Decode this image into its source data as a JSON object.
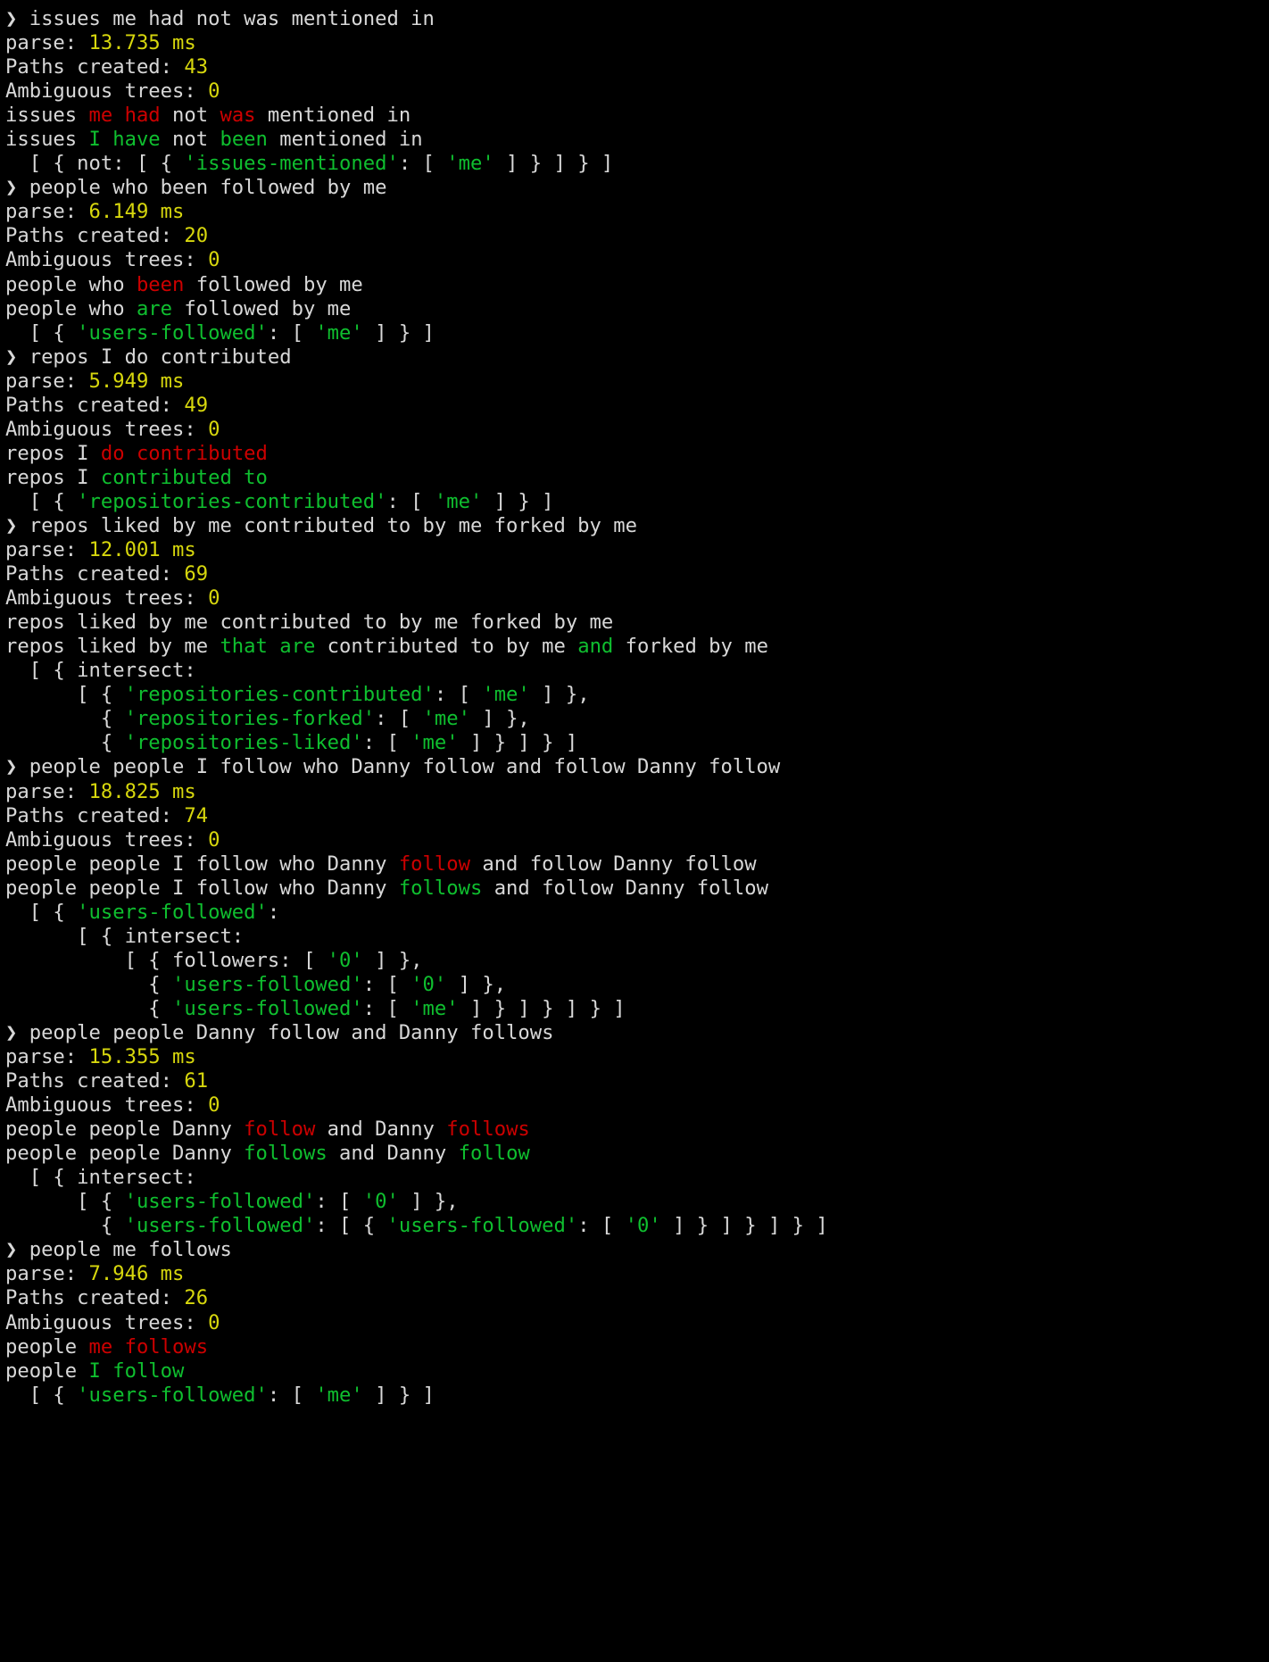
{
  "terminal": {
    "title": "terminal-session",
    "background_color": "#000000",
    "colors": {
      "white": "#d8d8d8",
      "red": "#cc0000",
      "green": "#0fbf2f",
      "yellow": "#d7d70d"
    },
    "prompt_symbol": "❯",
    "labels": {
      "parse": "parse:",
      "paths_created": "Paths created:",
      "ambiguous_trees": "Ambiguous trees:",
      "ms_unit": "ms"
    },
    "sessions": [
      {
        "command": "issues me had not was mentioned in",
        "parse_time": "13.735",
        "paths_created": "43",
        "ambiguous_trees": "0",
        "input_line": [
          {
            "t": "issues ",
            "c": "white"
          },
          {
            "t": "me had",
            "c": "red"
          },
          {
            "t": " not ",
            "c": "white"
          },
          {
            "t": "was",
            "c": "red"
          },
          {
            "t": " mentioned in",
            "c": "white"
          }
        ],
        "corrected_line": [
          {
            "t": "issues ",
            "c": "white"
          },
          {
            "t": "I have",
            "c": "green"
          },
          {
            "t": " not ",
            "c": "white"
          },
          {
            "t": "been",
            "c": "green"
          },
          {
            "t": " mentioned in",
            "c": "white"
          }
        ],
        "result_lines": [
          [
            {
              "t": "  [ { not: [ { ",
              "c": "white"
            },
            {
              "t": "'issues-mentioned'",
              "c": "green"
            },
            {
              "t": ": [ ",
              "c": "white"
            },
            {
              "t": "'me'",
              "c": "green"
            },
            {
              "t": " ] } ] } ]",
              "c": "white"
            }
          ]
        ]
      },
      {
        "command": "people who been followed by me",
        "parse_time": "6.149",
        "paths_created": "20",
        "ambiguous_trees": "0",
        "input_line": [
          {
            "t": "people who ",
            "c": "white"
          },
          {
            "t": "been",
            "c": "red"
          },
          {
            "t": " followed by me",
            "c": "white"
          }
        ],
        "corrected_line": [
          {
            "t": "people who ",
            "c": "white"
          },
          {
            "t": "are",
            "c": "green"
          },
          {
            "t": " followed by me",
            "c": "white"
          }
        ],
        "result_lines": [
          [
            {
              "t": "  [ { ",
              "c": "white"
            },
            {
              "t": "'users-followed'",
              "c": "green"
            },
            {
              "t": ": [ ",
              "c": "white"
            },
            {
              "t": "'me'",
              "c": "green"
            },
            {
              "t": " ] } ]",
              "c": "white"
            }
          ]
        ]
      },
      {
        "command": "repos I do contributed",
        "parse_time": "5.949",
        "paths_created": "49",
        "ambiguous_trees": "0",
        "input_line": [
          {
            "t": "repos I ",
            "c": "white"
          },
          {
            "t": "do contributed",
            "c": "red"
          }
        ],
        "corrected_line": [
          {
            "t": "repos I ",
            "c": "white"
          },
          {
            "t": "contributed to",
            "c": "green"
          }
        ],
        "result_lines": [
          [
            {
              "t": "  [ { ",
              "c": "white"
            },
            {
              "t": "'repositories-contributed'",
              "c": "green"
            },
            {
              "t": ": [ ",
              "c": "white"
            },
            {
              "t": "'me'",
              "c": "green"
            },
            {
              "t": " ] } ]",
              "c": "white"
            }
          ]
        ]
      },
      {
        "command": "repos liked by me contributed to by me forked by me",
        "parse_time": "12.001",
        "paths_created": "69",
        "ambiguous_trees": "0",
        "input_line": [
          {
            "t": "repos liked by me contributed to by me forked by me",
            "c": "white"
          }
        ],
        "corrected_line": [
          {
            "t": "repos liked by me ",
            "c": "white"
          },
          {
            "t": "that are",
            "c": "green"
          },
          {
            "t": " contributed to by me ",
            "c": "white"
          },
          {
            "t": "and",
            "c": "green"
          },
          {
            "t": " forked by me",
            "c": "white"
          }
        ],
        "result_lines": [
          [
            {
              "t": "  [ { intersect:",
              "c": "white"
            }
          ],
          [
            {
              "t": "      [ { ",
              "c": "white"
            },
            {
              "t": "'repositories-contributed'",
              "c": "green"
            },
            {
              "t": ": [ ",
              "c": "white"
            },
            {
              "t": "'me'",
              "c": "green"
            },
            {
              "t": " ] },",
              "c": "white"
            }
          ],
          [
            {
              "t": "        { ",
              "c": "white"
            },
            {
              "t": "'repositories-forked'",
              "c": "green"
            },
            {
              "t": ": [ ",
              "c": "white"
            },
            {
              "t": "'me'",
              "c": "green"
            },
            {
              "t": " ] },",
              "c": "white"
            }
          ],
          [
            {
              "t": "        { ",
              "c": "white"
            },
            {
              "t": "'repositories-liked'",
              "c": "green"
            },
            {
              "t": ": [ ",
              "c": "white"
            },
            {
              "t": "'me'",
              "c": "green"
            },
            {
              "t": " ] } ] } ]",
              "c": "white"
            }
          ]
        ]
      },
      {
        "command": "people people I follow who Danny follow and follow Danny follow",
        "parse_time": "18.825",
        "paths_created": "74",
        "ambiguous_trees": "0",
        "input_line": [
          {
            "t": "people people I follow who Danny ",
            "c": "white"
          },
          {
            "t": "follow",
            "c": "red"
          },
          {
            "t": " and follow Danny follow",
            "c": "white"
          }
        ],
        "corrected_line": [
          {
            "t": "people people I follow who Danny ",
            "c": "white"
          },
          {
            "t": "follows",
            "c": "green"
          },
          {
            "t": " and follow Danny follow",
            "c": "white"
          }
        ],
        "result_lines": [
          [
            {
              "t": "  [ { ",
              "c": "white"
            },
            {
              "t": "'users-followed'",
              "c": "green"
            },
            {
              "t": ":",
              "c": "white"
            }
          ],
          [
            {
              "t": "      [ { intersect:",
              "c": "white"
            }
          ],
          [
            {
              "t": "          [ { followers: [ ",
              "c": "white"
            },
            {
              "t": "'0'",
              "c": "green"
            },
            {
              "t": " ] },",
              "c": "white"
            }
          ],
          [
            {
              "t": "            { ",
              "c": "white"
            },
            {
              "t": "'users-followed'",
              "c": "green"
            },
            {
              "t": ": [ ",
              "c": "white"
            },
            {
              "t": "'0'",
              "c": "green"
            },
            {
              "t": " ] },",
              "c": "white"
            }
          ],
          [
            {
              "t": "            { ",
              "c": "white"
            },
            {
              "t": "'users-followed'",
              "c": "green"
            },
            {
              "t": ": [ ",
              "c": "white"
            },
            {
              "t": "'me'",
              "c": "green"
            },
            {
              "t": " ] } ] } ] } ]",
              "c": "white"
            }
          ]
        ]
      },
      {
        "command": "people people Danny follow and Danny follows",
        "parse_time": "15.355",
        "paths_created": "61",
        "ambiguous_trees": "0",
        "input_line": [
          {
            "t": "people people Danny ",
            "c": "white"
          },
          {
            "t": "follow",
            "c": "red"
          },
          {
            "t": " and Danny ",
            "c": "white"
          },
          {
            "t": "follows",
            "c": "red"
          }
        ],
        "corrected_line": [
          {
            "t": "people people Danny ",
            "c": "white"
          },
          {
            "t": "follows",
            "c": "green"
          },
          {
            "t": " and Danny ",
            "c": "white"
          },
          {
            "t": "follow",
            "c": "green"
          }
        ],
        "result_lines": [
          [
            {
              "t": "  [ { intersect:",
              "c": "white"
            }
          ],
          [
            {
              "t": "      [ { ",
              "c": "white"
            },
            {
              "t": "'users-followed'",
              "c": "green"
            },
            {
              "t": ": [ ",
              "c": "white"
            },
            {
              "t": "'0'",
              "c": "green"
            },
            {
              "t": " ] },",
              "c": "white"
            }
          ],
          [
            {
              "t": "        { ",
              "c": "white"
            },
            {
              "t": "'users-followed'",
              "c": "green"
            },
            {
              "t": ": [ { ",
              "c": "white"
            },
            {
              "t": "'users-followed'",
              "c": "green"
            },
            {
              "t": ": [ ",
              "c": "white"
            },
            {
              "t": "'0'",
              "c": "green"
            },
            {
              "t": " ] } ] } ] } ]",
              "c": "white"
            }
          ]
        ]
      },
      {
        "command": "people me follows",
        "parse_time": "7.946",
        "paths_created": "26",
        "ambiguous_trees": "0",
        "input_line": [
          {
            "t": "people ",
            "c": "white"
          },
          {
            "t": "me follows",
            "c": "red"
          }
        ],
        "corrected_line": [
          {
            "t": "people ",
            "c": "white"
          },
          {
            "t": "I follow",
            "c": "green"
          }
        ],
        "result_lines": [
          [
            {
              "t": "  [ { ",
              "c": "white"
            },
            {
              "t": "'users-followed'",
              "c": "green"
            },
            {
              "t": ": [ ",
              "c": "white"
            },
            {
              "t": "'me'",
              "c": "green"
            },
            {
              "t": " ] } ]",
              "c": "white"
            }
          ]
        ]
      }
    ]
  }
}
